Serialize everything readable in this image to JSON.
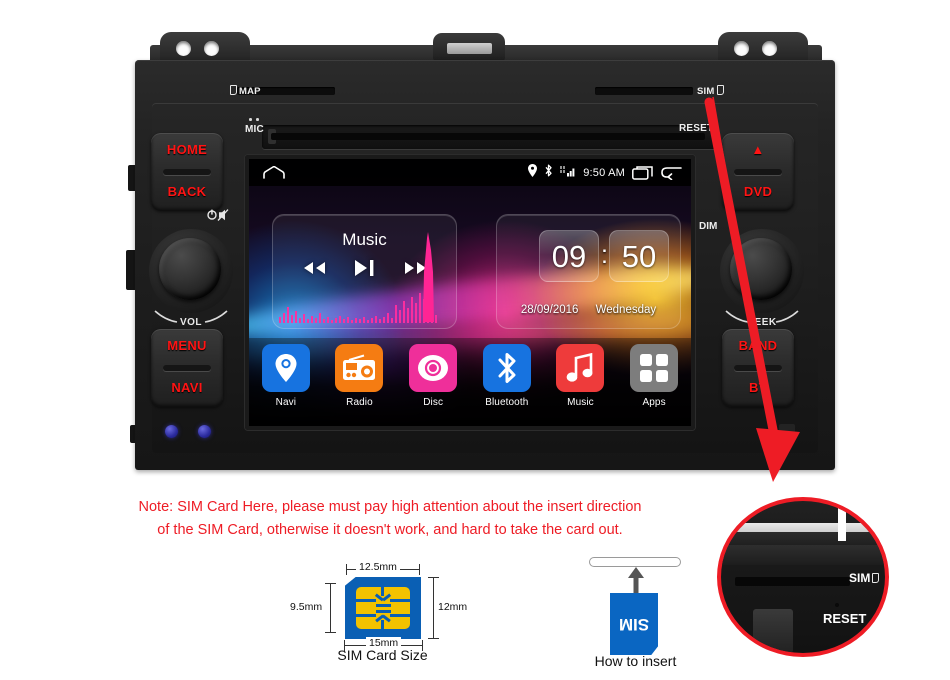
{
  "device": {
    "top_labels": {
      "map": "MAP",
      "sim": "SIM",
      "mic": "MIC",
      "reset": "RESET"
    },
    "left_buttons": {
      "home": "HOME",
      "back": "BACK",
      "menu": "MENU",
      "navi": "NAVI",
      "vol": "VOL"
    },
    "right_buttons": {
      "eject": "▲",
      "dvd": "DVD",
      "band": "BAND",
      "bt": "BT",
      "seek": "SEEK",
      "dim": "DIM"
    }
  },
  "screen": {
    "statusbar": {
      "icons": [
        "location-icon",
        "bluetooth-icon",
        "signal-icon",
        "recents-icon",
        "back-icon"
      ],
      "clock": "9:50 AM"
    },
    "music_widget": {
      "title": "Music",
      "controls": [
        "previous-track",
        "play-pause",
        "next-track"
      ]
    },
    "clock_widget": {
      "hours": "09",
      "separator": ":",
      "minutes": "50",
      "date": "28/09/2016",
      "weekday": "Wednesday"
    },
    "apps": [
      {
        "name": "Navi",
        "icon": "location-pin-icon",
        "color": "#1773e0"
      },
      {
        "name": "Radio",
        "icon": "radio-icon",
        "color": "#f57c12"
      },
      {
        "name": "Disc",
        "icon": "disc-icon",
        "color": "#ef2f9a"
      },
      {
        "name": "Bluetooth",
        "icon": "bluetooth-icon",
        "color": "#1773e0"
      },
      {
        "name": "Music",
        "icon": "music-note-icon",
        "color": "#ee3b3b"
      },
      {
        "name": "Apps",
        "icon": "grid-apps-icon",
        "color": "#7d7d7d"
      }
    ]
  },
  "annotations": {
    "note_line1": "Note: SIM Card Here, please must pay high attention about the insert direction",
    "note_line2": "of the SIM Card, otherwise it doesn't work, and hard to take the card out.",
    "note_color": "#ee1c25",
    "arrow_color": "#ee1c25"
  },
  "inset": {
    "sim": "SIM",
    "reset": "RESET"
  },
  "sim_diagram": {
    "width_top": "12.5mm",
    "width_bottom": "15mm",
    "height_left": "9.5mm",
    "height_right": "12mm",
    "caption": "SIM Card Size"
  },
  "how_to_insert": {
    "card_label": "SIM",
    "caption": "How to insert"
  }
}
